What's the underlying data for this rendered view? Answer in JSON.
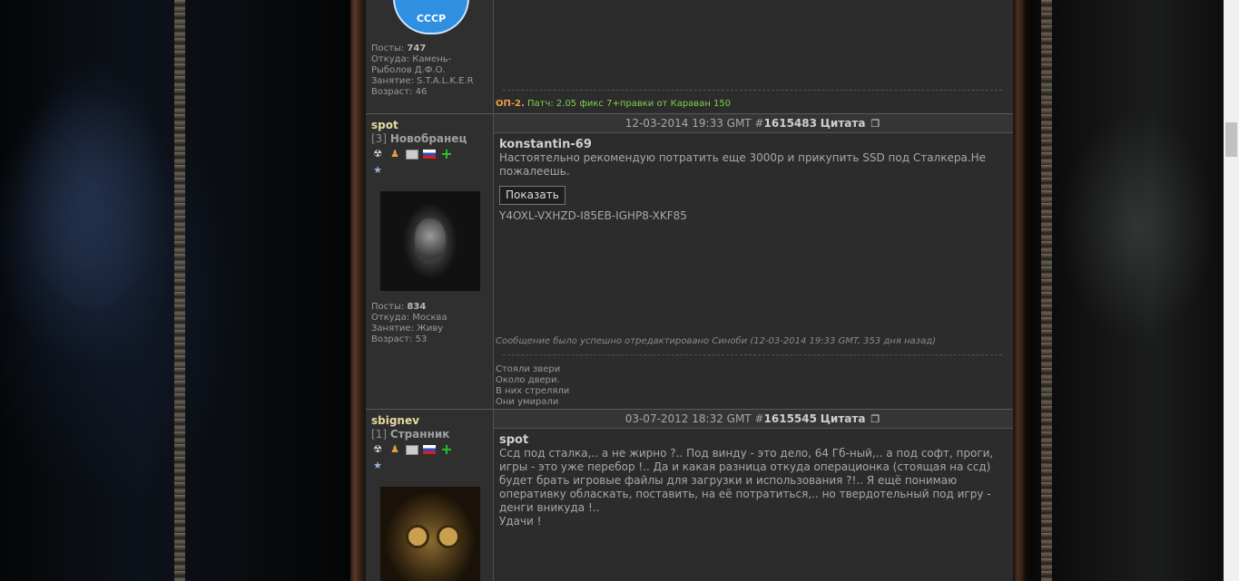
{
  "posts": [
    {
      "user": {
        "emblem": "СССР",
        "posts_label": "Посты:",
        "posts_value": "747",
        "from_label": "Откуда:",
        "from_value": "Камень-Рыболов Д.Ф.О.",
        "occupation_label": "Занятие:",
        "occupation_value": "S.T.A.L.K.E.R",
        "age_label": "Возраст:",
        "age_value": "46"
      },
      "signature": {
        "prefix": "ОП-2.",
        "text": "Патч: 2.05 фикс 7+правки от Караван 150"
      }
    },
    {
      "user": {
        "name": "spot",
        "rank_num": "[3]",
        "rank_title": "Новобранец",
        "posts_label": "Посты:",
        "posts_value": "834",
        "from_label": "Откуда:",
        "from_value": "Москва",
        "occupation_label": "Занятие:",
        "occupation_value": "Живу",
        "age_label": "Возраст:",
        "age_value": "53"
      },
      "header": {
        "date": "12-03-2014 19:33 GMT #",
        "number": "1615483",
        "quote": "Цитата"
      },
      "quote_author": "konstantin-69",
      "text": "Настоятельно рекомендую потратить еще 3000р и прикупить SSD под Сталкера.Не пожалеешь.",
      "show_button": "Показать",
      "hidden_text": "Y4OXL-VXHZD-I85EB-IGHP8-XKF85",
      "edited": "Сообщение было успешно отредактировано Синоби (12-03-2014 19:33 GMT, 353 дня назад)",
      "signature_lines": [
        "Стояли звери",
        "Около двери.",
        "В них стреляли",
        "Они умирали"
      ]
    },
    {
      "user": {
        "name": "sbignev",
        "rank_num": "[1]",
        "rank_title": "Странник"
      },
      "header": {
        "date": "03-07-2012 18:32 GMT #",
        "number": "1615545",
        "quote": "Цитата"
      },
      "quote_author": "spot",
      "lines": [
        "Ссд под сталка,.. а не жирно ?.. Под винду - это дело, 64 Гб-ный,.. а под софт, проги,",
        "игры - это уже перебор !.. Да и какая разница откуда операционка (стоящая на ссд)",
        "будет брать игровые файлы для загрузки и использования ?!.. Я ещё понимаю",
        "оперативку обласкать, поставить, на её потратиться,.. но твердотельный под игру -",
        "денги вникуда !..",
        "Удачи !"
      ]
    }
  ],
  "colors": {
    "username": "#e8d9a0",
    "sig_prefix": "#e8a040",
    "sig_text": "#7ed04a"
  }
}
